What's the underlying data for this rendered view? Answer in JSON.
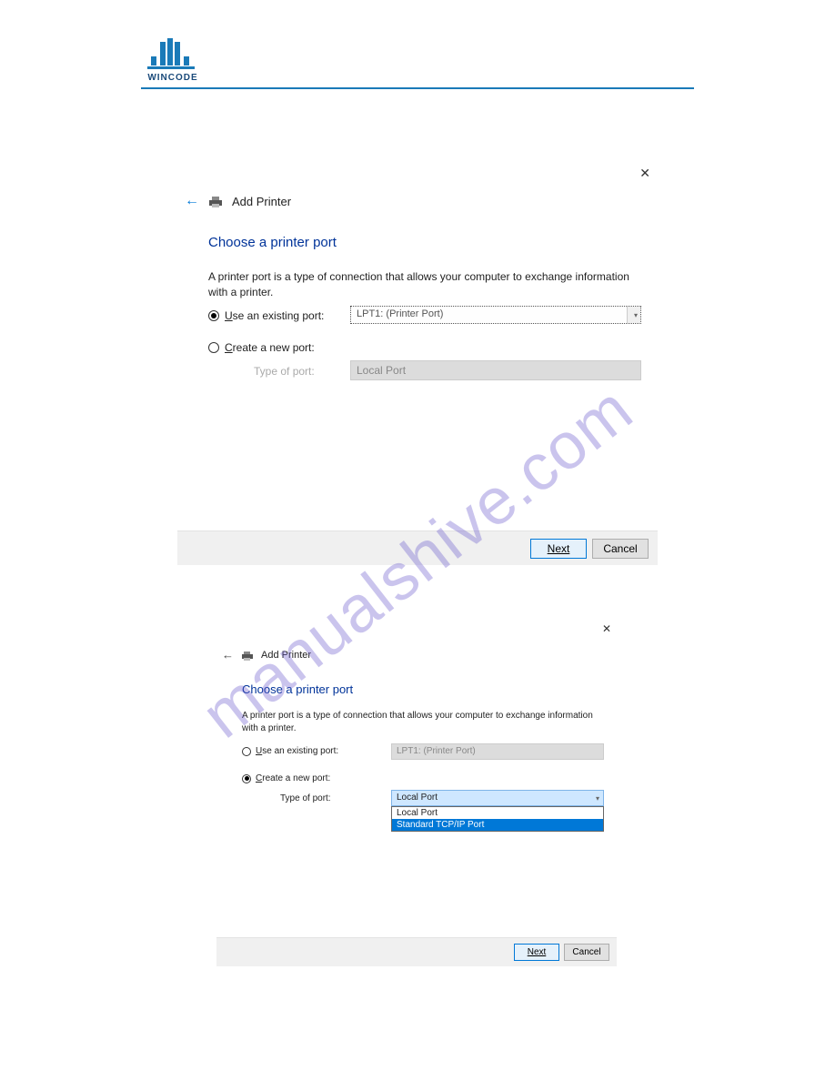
{
  "brand": "WINCODE",
  "watermark": "manualshive.com",
  "dlg1": {
    "crumb": "Add Printer",
    "title": "Choose a printer port",
    "desc": "A printer port is a type of connection that allows your computer to exchange information with a printer.",
    "opt_existing": "Use an existing port:",
    "opt_create": "Create a new port:",
    "combo_existing": "LPT1: (Printer Port)",
    "type_label": "Type of port:",
    "combo_type": "Local Port",
    "btn_next": "Next",
    "btn_cancel": "Cancel"
  },
  "dlg2": {
    "crumb": "Add Printer",
    "title": "Choose a printer port",
    "desc": "A printer port is a type of connection that allows your computer to exchange information with a printer.",
    "opt_existing": "Use an existing port:",
    "opt_create": "Create a new port:",
    "combo_existing": "LPT1: (Printer Port)",
    "type_label": "Type of port:",
    "combo_type": "Local Port",
    "dropdown": {
      "opt0": "Local Port",
      "opt1": "Standard TCP/IP Port"
    },
    "btn_next": "Next",
    "btn_cancel": "Cancel"
  }
}
